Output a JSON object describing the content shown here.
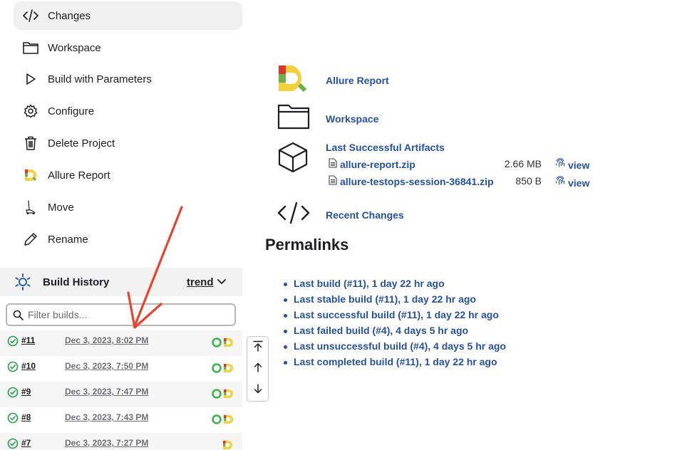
{
  "sidebar": {
    "tasks": [
      {
        "label": "Changes",
        "icon": "code-icon"
      },
      {
        "label": "Workspace",
        "icon": "folder-icon"
      },
      {
        "label": "Build with Parameters",
        "icon": "play-icon"
      },
      {
        "label": "Configure",
        "icon": "gear-icon"
      },
      {
        "label": "Delete Project",
        "icon": "trash-icon"
      },
      {
        "label": "Allure Report",
        "icon": "allure-icon"
      },
      {
        "label": "Move",
        "icon": "move-icon"
      },
      {
        "label": "Rename",
        "icon": "pencil-icon"
      }
    ]
  },
  "build_history": {
    "title": "Build History",
    "trend_label": "trend",
    "filter_placeholder": "Filter builds...",
    "builds": [
      {
        "number": "#11",
        "date": "Dec 3, 2023, 8:02 PM",
        "status": "success"
      },
      {
        "number": "#10",
        "date": "Dec 3, 2023, 7:50 PM",
        "status": "success"
      },
      {
        "number": "#9",
        "date": "Dec 3, 2023, 7:47 PM",
        "status": "success"
      },
      {
        "number": "#8",
        "date": "Dec 3, 2023, 7:43 PM",
        "status": "success"
      },
      {
        "number": "#7",
        "date": "Dec 3, 2023, 7:27 PM",
        "status": "success"
      }
    ]
  },
  "main": {
    "allure_report": "Allure Report",
    "workspace": "Workspace",
    "artifacts_title": "Last Successful Artifacts",
    "artifacts": [
      {
        "name": "allure-report.zip",
        "size": "2.66 MB",
        "view": "view"
      },
      {
        "name": "allure-testops-session-36841.zip",
        "size": "850 B",
        "view": "view"
      }
    ],
    "recent_changes": "Recent Changes"
  },
  "permalinks": {
    "title": "Permalinks",
    "items": [
      "Last build (#11), 1 day 22 hr ago",
      "Last stable build (#11), 1 day 22 hr ago",
      "Last successful build (#11), 1 day 22 hr ago",
      "Last failed build (#4), 4 days 5 hr ago",
      "Last unsuccessful build (#4), 4 days 5 hr ago",
      "Last completed build (#11), 1 day 22 hr ago"
    ]
  },
  "colors": {
    "link": "#2451a3",
    "success": "#1ea446",
    "annotation_arrow": "#e8442e",
    "allure_yellow": "#f2d13c",
    "allure_red": "#e0342d",
    "allure_green": "#6bb04a"
  }
}
